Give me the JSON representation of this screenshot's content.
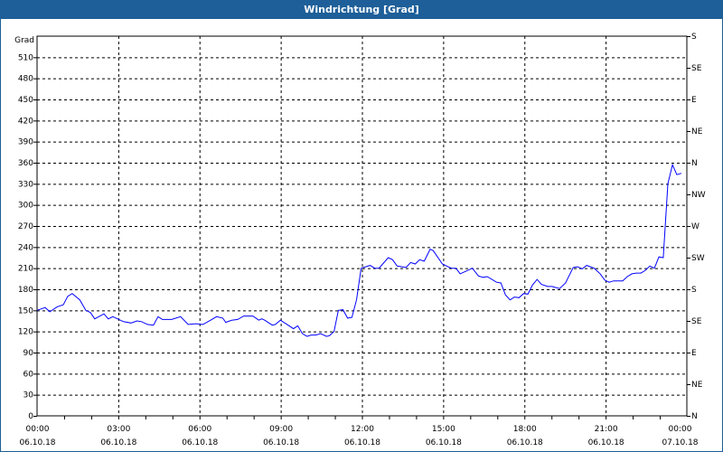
{
  "window": {
    "title": "Windrichtung [Grad]"
  },
  "chart_data": {
    "type": "line",
    "title": "Windrichtung [Grad]",
    "ylabel": "Grad",
    "xlabel": "",
    "ylim": [
      0,
      540
    ],
    "xlim_hours": [
      0,
      24
    ],
    "grid": true,
    "y_ticks": [
      0,
      30,
      60,
      90,
      120,
      150,
      180,
      210,
      240,
      270,
      300,
      330,
      360,
      390,
      420,
      450,
      480,
      510
    ],
    "right_axis_labels": [
      {
        "value": 0,
        "label": "N"
      },
      {
        "value": 45,
        "label": "NE"
      },
      {
        "value": 90,
        "label": "E"
      },
      {
        "value": 135,
        "label": "SE"
      },
      {
        "value": 180,
        "label": "S"
      },
      {
        "value": 225,
        "label": "SW"
      },
      {
        "value": 270,
        "label": "W"
      },
      {
        "value": 315,
        "label": "NW"
      },
      {
        "value": 360,
        "label": "N"
      },
      {
        "value": 405,
        "label": "NE"
      },
      {
        "value": 450,
        "label": "E"
      },
      {
        "value": 495,
        "label": "SE"
      },
      {
        "value": 540,
        "label": "S"
      }
    ],
    "x_ticks": [
      {
        "hour": 0,
        "time": "00:00",
        "date": "06.10.18"
      },
      {
        "hour": 3,
        "time": "03:00",
        "date": "06.10.18"
      },
      {
        "hour": 6,
        "time": "06:00",
        "date": "06.10.18"
      },
      {
        "hour": 9,
        "time": "09:00",
        "date": "06.10.18"
      },
      {
        "hour": 12,
        "time": "12:00",
        "date": "06.10.18"
      },
      {
        "hour": 15,
        "time": "15:00",
        "date": "06.10.18"
      },
      {
        "hour": 18,
        "time": "18:00",
        "date": "06.10.18"
      },
      {
        "hour": 21,
        "time": "21:00",
        "date": "06.10.18"
      },
      {
        "hour": 24,
        "time": "00:00",
        "date": "07.10.18"
      }
    ],
    "series": [
      {
        "name": "Windrichtung",
        "color": "#0000ff",
        "x": [
          0,
          0.3,
          0.47,
          0.74,
          0.97,
          1.13,
          1.3,
          1.58,
          1.8,
          1.97,
          2.13,
          2.47,
          2.63,
          2.8,
          2.97,
          3.19,
          3.47,
          3.69,
          3.86,
          4.08,
          4.3,
          4.47,
          4.63,
          4.97,
          5.3,
          5.58,
          5.86,
          6.13,
          6.41,
          6.63,
          6.86,
          6.97,
          7.19,
          7.41,
          7.63,
          7.97,
          8.19,
          8.3,
          8.41,
          8.69,
          8.8,
          8.99,
          9.19,
          9.47,
          9.63,
          9.8,
          9.97,
          10.13,
          10.3,
          10.47,
          10.69,
          10.8,
          10.97,
          11.13,
          11.3,
          11.47,
          11.63,
          11.8,
          11.97,
          12.3,
          12.47,
          12.63,
          12.97,
          13.13,
          13.3,
          13.63,
          13.8,
          13.97,
          14.13,
          14.3,
          14.52,
          14.63,
          14.97,
          15.13,
          15.3,
          15.47,
          15.63,
          15.8,
          16.08,
          16.3,
          16.47,
          16.63,
          16.97,
          17.13,
          17.3,
          17.47,
          17.63,
          17.8,
          17.97,
          18.13,
          18.3,
          18.47,
          18.63,
          18.86,
          19.02,
          19.3,
          19.52,
          19.8,
          19.97,
          20.13,
          20.3,
          20.58,
          20.8,
          20.97,
          21.13,
          21.3,
          21.63,
          21.8,
          21.97,
          22.13,
          22.3,
          22.47,
          22.63,
          22.8,
          22.97,
          23.13,
          23.3,
          23.47,
          23.63,
          23.8
        ],
        "values": [
          150,
          154,
          148,
          155,
          158,
          170,
          174,
          165,
          150,
          147,
          138,
          145,
          138,
          141,
          138,
          134,
          132,
          135,
          134,
          130,
          129,
          141,
          137,
          137,
          141,
          130,
          131,
          130,
          136,
          141,
          139,
          133,
          136,
          137,
          142,
          142,
          136,
          138,
          136,
          129,
          130,
          136,
          131,
          124,
          128,
          117,
          113,
          115,
          115,
          117,
          113,
          114,
          120,
          150,
          151,
          139,
          140,
          165,
          210,
          214,
          210,
          210,
          225,
          222,
          213,
          211,
          218,
          216,
          222,
          220,
          237,
          235,
          216,
          213,
          210,
          210,
          202,
          205,
          210,
          199,
          197,
          198,
          190,
          189,
          172,
          165,
          169,
          168,
          174,
          173,
          186,
          194,
          187,
          184,
          184,
          181,
          189,
          211,
          212,
          209,
          214,
          210,
          202,
          193,
          190,
          192,
          192,
          198,
          202,
          203,
          203,
          207,
          213,
          210,
          226,
          225,
          330,
          357,
          343,
          345
        ]
      }
    ]
  }
}
